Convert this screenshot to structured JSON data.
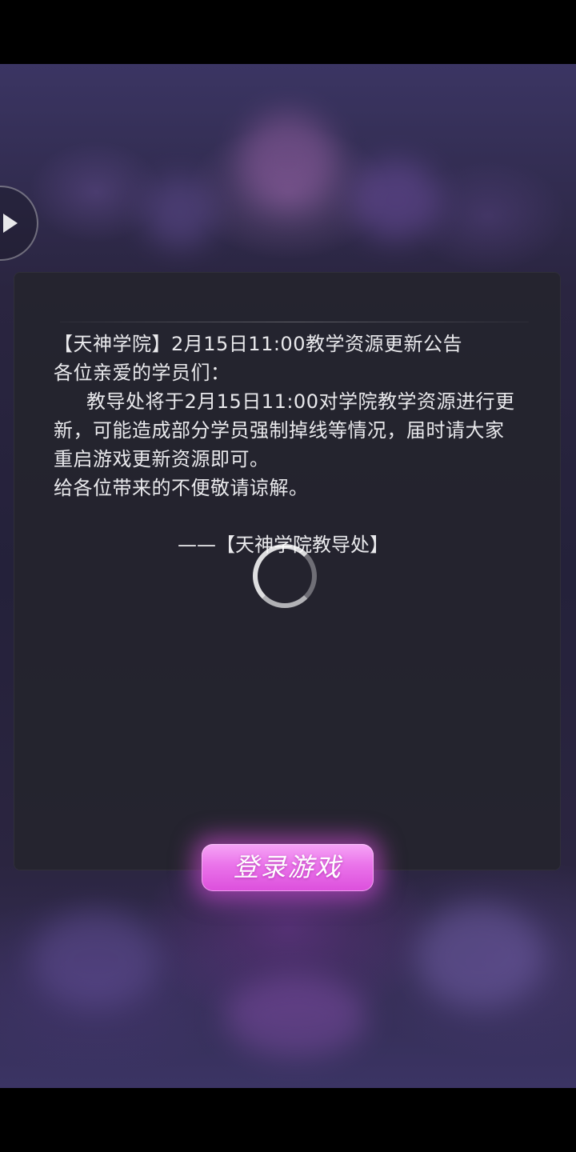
{
  "notice": {
    "title": "【天神学院】2月15日11:00教学资源更新公告",
    "greeting": "各位亲爱的学员们：",
    "body_line1": "教导处将于2月15日11:00对学院教学资源进行更",
    "body_line2": "新，可能造成部分学员强制掉线等情况，届时请大家",
    "body_line3": "重启游戏更新资源即可。",
    "apology": "给各位带来的不便敬请谅解。",
    "signature": "——【天神学院教导处】"
  },
  "login_button": {
    "label": "登录游戏"
  },
  "icons": {
    "side_button": "play-icon",
    "loading": "loading-spinner-icon"
  },
  "colors": {
    "button_accent": "#e86ee8",
    "panel_bg": "#24242c",
    "text": "#e9e9ec"
  }
}
